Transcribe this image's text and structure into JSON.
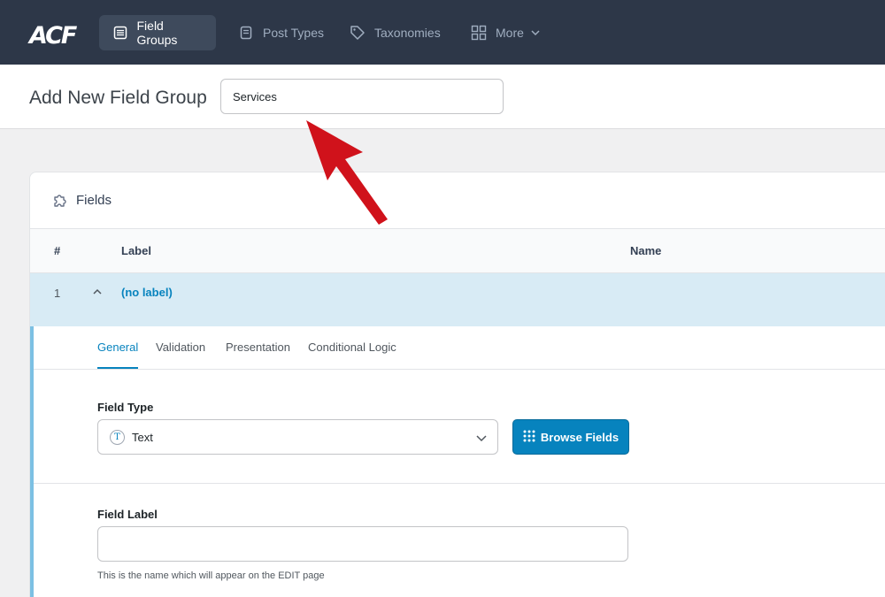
{
  "nav": {
    "logo": "ACF",
    "items": [
      {
        "label": "Field Groups",
        "icon": "list-icon",
        "active": true
      },
      {
        "label": "Post Types",
        "icon": "document-icon",
        "active": false
      },
      {
        "label": "Taxonomies",
        "icon": "tag-icon",
        "active": false
      },
      {
        "label": "More",
        "icon": "grid-icon",
        "active": false
      }
    ]
  },
  "header": {
    "title": "Add New Field Group",
    "title_input_value": "Services"
  },
  "panel": {
    "title": "Fields",
    "columns": {
      "num": "#",
      "label": "Label",
      "name": "Name"
    },
    "field": {
      "num": "1",
      "label": "(no label)"
    },
    "tabs": [
      "General",
      "Validation",
      "Presentation",
      "Conditional Logic"
    ],
    "field_type": {
      "label": "Field Type",
      "value": "Text",
      "icon_letter": "T"
    },
    "browse_button": "Browse Fields",
    "field_label": {
      "label": "Field Label",
      "value": "",
      "hint": "This is the name which will appear on the EDIT page"
    }
  },
  "colors": {
    "nav_bg": "#2d3748",
    "accent": "#0783be",
    "row_highlight": "#d8ebf5",
    "arrow": "#d0121b"
  }
}
